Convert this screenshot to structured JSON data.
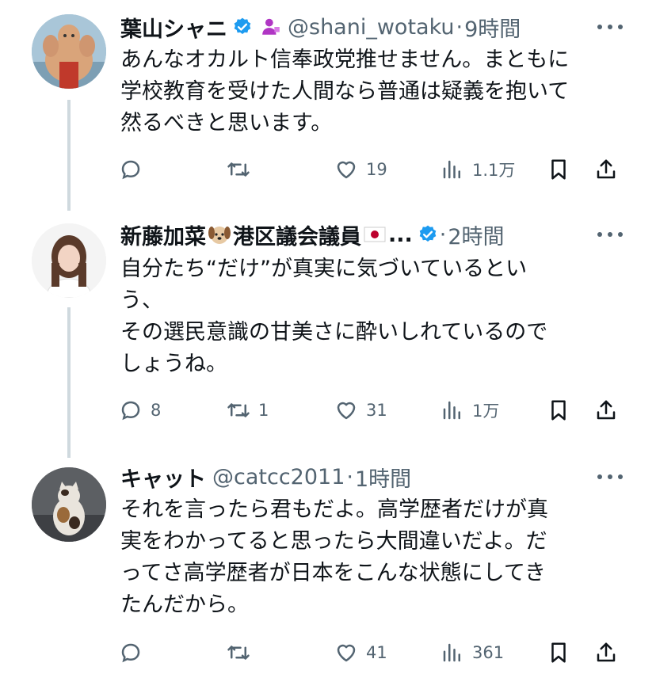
{
  "tweets": [
    {
      "author_name": "葉山シャニ",
      "handle": "@shani_wotaku",
      "dot": "·",
      "time": "9時間",
      "text": "あんなオカルト信奉政党推せません。まともに\n学校教育を受けた人間なら普通は疑義を抱いて\n然るべきと思います。",
      "stats": {
        "replies": "",
        "retweets": "",
        "likes": "19",
        "views": "1.1万"
      }
    },
    {
      "author_name": "新藤加菜",
      "name_suffix": "港区議会議員",
      "ellipsis": "...",
      "dot": "·",
      "time": "2時間",
      "text": "自分たち“だけ”が真実に気づいているとい\nう、\nその選民意識の甘美さに酔いしれているので\nしょうね。",
      "stats": {
        "replies": "8",
        "retweets": "1",
        "likes": "31",
        "views": "1万"
      }
    },
    {
      "author_name": "キャット",
      "handle": "@catcc2011",
      "dot": "·",
      "time": "1時間",
      "text": "それを言ったら君もだよ。高学歴者だけが真\n実をわかってると思ったら大間違いだよ。だ\nってさ高学歴者が日本をこんな状態にしてき\nたんだから。",
      "stats": {
        "replies": "",
        "retweets": "",
        "likes": "41",
        "views": "361"
      }
    }
  ],
  "colors": {
    "verified": "#1d9bf0",
    "secondary_text": "#536471",
    "thread_line": "#cfd9de",
    "purple_badge": "#b036c4"
  },
  "icons": [
    "reply-icon",
    "retweet-icon",
    "like-icon",
    "views-icon",
    "bookmark-icon",
    "share-icon",
    "more-icon",
    "verified-badge-icon",
    "dog-emoji-icon",
    "japan-flag-icon"
  ]
}
